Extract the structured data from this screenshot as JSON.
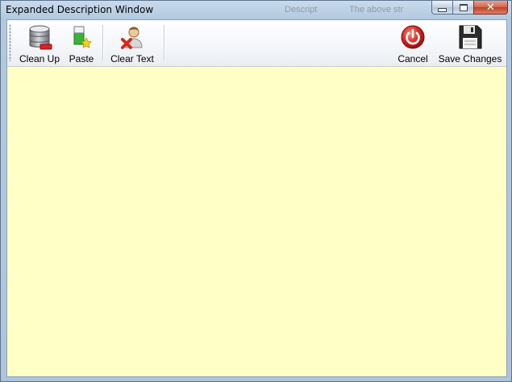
{
  "window": {
    "title": "Expanded Description Window",
    "caption_buttons": {
      "minimize": "minimize",
      "maximize": "maximize",
      "close": "close"
    }
  },
  "toolbar": {
    "clean_up_label": "Clean Up",
    "paste_label": "Paste",
    "clear_text_label": "Clear Text",
    "cancel_label": "Cancel",
    "save_changes_label": "Save Changes",
    "icons": {
      "clean_up": "database-clean-icon",
      "paste": "paste-icon",
      "clear_text": "user-delete-icon",
      "cancel": "power-icon",
      "save_changes": "save-disk-icon"
    }
  },
  "editor": {
    "value": "",
    "background": "#ffffc6"
  },
  "background_app": {
    "left_text": "Descript",
    "right_text": "The above str"
  },
  "colors": {
    "close_red": "#c9452a",
    "cancel_red": "#d21f1f",
    "editor_yellow": "#ffffc6"
  }
}
